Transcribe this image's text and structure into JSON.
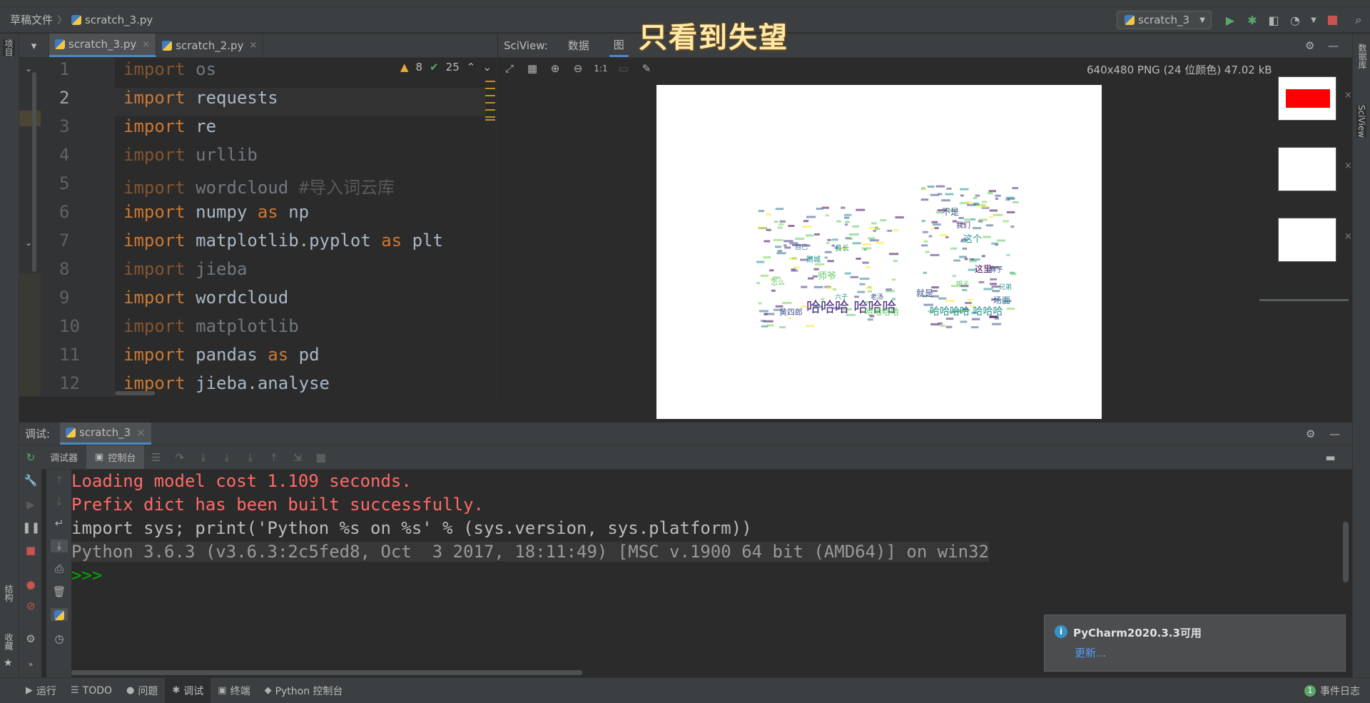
{
  "breadcrumb": {
    "root": "草稿文件",
    "file": "scratch_3.py"
  },
  "run_config": {
    "name": "scratch_3"
  },
  "left_stripe": {
    "project": "项目",
    "structure": "结构",
    "favorites": "收藏"
  },
  "right_stripe": {
    "database": "数据库",
    "sciview": "SciView"
  },
  "editor": {
    "tabs": [
      {
        "label": "scratch_3.py",
        "close": "×"
      },
      {
        "label": "scratch_2.py",
        "close": "×"
      }
    ],
    "inspections": {
      "warnings": "8",
      "ok": "25"
    },
    "lines": [
      {
        "num": "1",
        "kw": "import",
        "rest": " os",
        "dim": true
      },
      {
        "num": "2",
        "kw": "import",
        "rest": " requests",
        "dim": false
      },
      {
        "num": "3",
        "kw": "import",
        "rest": " re",
        "dim": false
      },
      {
        "num": "4",
        "kw": "import",
        "rest": " urllib",
        "dim": true
      },
      {
        "num": "5",
        "kw": "import",
        "rest": " wordcloud ",
        "comment": "#导入词云库",
        "dim": true
      },
      {
        "num": "6",
        "kw": "import",
        "rest": " numpy ",
        "kw2": "as",
        "rest2": " np",
        "dim": false
      },
      {
        "num": "7",
        "kw": "import",
        "rest": " matplotlib.pyplot ",
        "kw2": "as",
        "rest2": " plt",
        "dim": false
      },
      {
        "num": "8",
        "kw": "import",
        "rest": " jieba",
        "dim": true
      },
      {
        "num": "9",
        "kw": "import",
        "rest": " wordcloud",
        "dim": false
      },
      {
        "num": "10",
        "kw": "import",
        "rest": " matplotlib",
        "dim": true
      },
      {
        "num": "11",
        "kw": "import",
        "rest": " pandas ",
        "kw2": "as",
        "rest2": " pd",
        "dim": false
      },
      {
        "num": "12",
        "kw": "import",
        "rest": " jieba.analyse",
        "dim": false
      }
    ]
  },
  "sciview": {
    "label": "SciView:",
    "tab_data": "数据",
    "tab_plot": "图",
    "overlay_title": "只看到失望",
    "image_info": "640x480 PNG (24 位颜色) 47.02 kB",
    "zoom_label": "1:1",
    "wordcloud_words": [
      "哈哈哈 哈哈哈",
      "哈哈哈哈 哈哈哈",
      "师爷",
      "就是",
      "这个",
      "不是",
      "场面",
      "这里",
      "黄四郎",
      "哈哈哈哈",
      "鹅城",
      "麻子",
      "县长",
      "怎么",
      "我们",
      "自己",
      "老汤",
      "六子",
      "银子",
      "兄弟"
    ]
  },
  "debug": {
    "label": "调试:",
    "tab": "scratch_3",
    "tab_close": "×",
    "subtab_debugger": "调试器",
    "subtab_console": "控制台"
  },
  "console": {
    "lines": [
      {
        "text": "Loading model cost 1.109 seconds.",
        "kind": "err"
      },
      {
        "text": "Prefix dict has been built successfully.",
        "kind": "err"
      },
      {
        "text": "import sys; print('Python %s on %s' % (sys.version, sys.platform))",
        "kind": "norm"
      },
      {
        "text": "Python 3.6.3 (v3.6.3:2c5fed8, Oct  3 2017, 18:11:49) [MSC v.1900 64 bit (AMD64)] on win32",
        "kind": "sys"
      },
      {
        "text": ">>>",
        "kind": "prompt"
      }
    ]
  },
  "notification": {
    "title": "PyCharm2020.3.3可用",
    "link": "更新..."
  },
  "statusbar": {
    "items": [
      {
        "icon": "▶",
        "label": "运行",
        "name": "run"
      },
      {
        "icon": "☰",
        "label": "TODO",
        "name": "todo"
      },
      {
        "icon": "●",
        "label": "问题",
        "name": "problems"
      },
      {
        "icon": "✱",
        "label": "调试",
        "name": "debug"
      },
      {
        "icon": "▣",
        "label": "终端",
        "name": "terminal"
      },
      {
        "icon": "◆",
        "label": "Python 控制台",
        "name": "python-console"
      }
    ],
    "event_log": "事件日志",
    "event_count": "1"
  }
}
